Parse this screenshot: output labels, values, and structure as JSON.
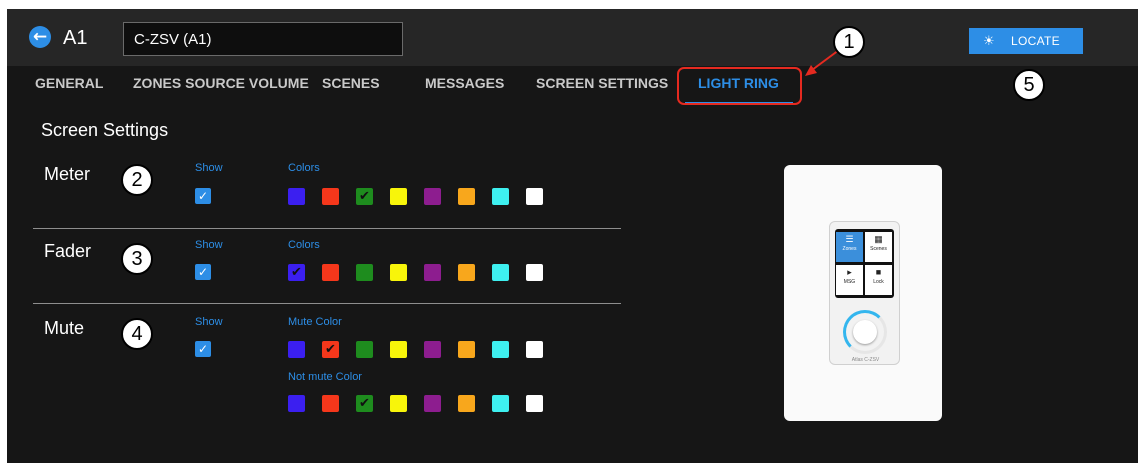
{
  "header": {
    "back_icon": "back-arrow-circle-icon",
    "device_id": "A1",
    "device_name": "C-ZSV (A1)",
    "locate_label": "LOCATE",
    "locate_icon": "light-bulb-icon"
  },
  "tabs": [
    {
      "label": "GENERAL",
      "active": false
    },
    {
      "label": "ZONES SOURCE VOLUME",
      "active": false
    },
    {
      "label": "SCENES",
      "active": false
    },
    {
      "label": "MESSAGES",
      "active": false
    },
    {
      "label": "SCREEN SETTINGS",
      "active": false
    },
    {
      "label": "LIGHT RING",
      "active": true
    }
  ],
  "callouts": [
    "1",
    "2",
    "3",
    "4",
    "5"
  ],
  "section_title": "Screen Settings",
  "palette": [
    "#3b1ff0",
    "#f5371b",
    "#1e8c1e",
    "#f8f50a",
    "#8d1d8f",
    "#f8a71c",
    "#3ef0f0",
    "#ffffff"
  ],
  "settings": {
    "meter": {
      "label": "Meter",
      "show_label": "Show",
      "show": true,
      "colors_label": "Colors",
      "selected_index": 2
    },
    "fader": {
      "label": "Fader",
      "show_label": "Show",
      "show": true,
      "colors_label": "Colors",
      "selected_index": 0
    },
    "mute": {
      "label": "Mute",
      "show_label": "Show",
      "show": true,
      "mute_color_label": "Mute Color",
      "mute_selected_index": 1,
      "not_mute_color_label": "Not mute Color",
      "not_mute_selected_index": 2
    }
  },
  "device_preview": {
    "tiles": [
      {
        "label": "Zones",
        "icon": "layers-icon",
        "active": true
      },
      {
        "label": "Scenes",
        "icon": "clapperboard-icon",
        "active": false
      },
      {
        "label": "MSG",
        "icon": "megaphone-icon",
        "active": false
      },
      {
        "label": "Lock",
        "icon": "lock-icon",
        "active": false
      }
    ],
    "brand": "Atlas C-ZSV"
  }
}
